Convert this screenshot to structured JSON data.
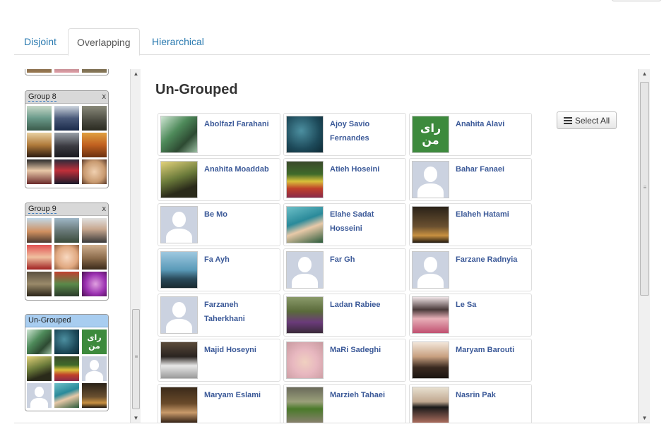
{
  "tabs": [
    {
      "label": "Disjoint",
      "active": false
    },
    {
      "label": "Overlapping",
      "active": true
    },
    {
      "label": "Hierarchical",
      "active": false
    }
  ],
  "sidebar": {
    "groups": [
      {
        "title": "Group 8",
        "close": "x",
        "thumbs": [
          "photo-lake",
          "photo-man-suit",
          "photo-dark",
          "photo-man-outdoor",
          "photo-couple",
          "photo-autumn",
          "photo-woman-scarf",
          "photo-boy-suit",
          "photo-baby"
        ]
      },
      {
        "title": "Group 9",
        "close": "x",
        "thumbs": [
          "photo-sunset",
          "photo-coast",
          "photo-woman-hijab",
          "photo-child-red",
          "photo-baby-face",
          "photo-child-smile",
          "photo-woman-shadow",
          "photo-crowd",
          "photo-purple"
        ]
      },
      {
        "title": "Un-Grouped",
        "close": "",
        "thumbs": [
          "photo-man-green",
          "photo-sea",
          "logo-green",
          "photo-woman-yellow",
          "photo-flowers",
          "placeholder",
          "placeholder",
          "photo-woman-teal",
          "photo-night"
        ]
      }
    ]
  },
  "main": {
    "title": "Un-Grouped",
    "select_all_label": "Select All",
    "people": [
      {
        "name": "Abolfazl Farahani",
        "photo": "photo-man-green"
      },
      {
        "name": "Ajoy Savio Fernandes",
        "photo": "photo-sea"
      },
      {
        "name": "Anahita Alavi",
        "photo": "logo-green"
      },
      {
        "name": "Anahita Moaddab",
        "photo": "photo-woman-yellow"
      },
      {
        "name": "Atieh Hoseini",
        "photo": "photo-flowers"
      },
      {
        "name": "Bahar Fanaei",
        "photo": "placeholder"
      },
      {
        "name": "Be Mo",
        "photo": "placeholder"
      },
      {
        "name": "Elahe Sadat Hosseini",
        "photo": "photo-woman-teal"
      },
      {
        "name": "Elaheh Hatami",
        "photo": "photo-night"
      },
      {
        "name": "Fa Ayh",
        "photo": "photo-beach"
      },
      {
        "name": "Far Gh",
        "photo": "placeholder"
      },
      {
        "name": "Farzane Radnyia",
        "photo": "placeholder"
      },
      {
        "name": "Farzaneh Taherkhani",
        "photo": "placeholder"
      },
      {
        "name": "Ladan Rabiee",
        "photo": "photo-woman-purple"
      },
      {
        "name": "Le Sa",
        "photo": "photo-girl-flowers"
      },
      {
        "name": "Majid Hoseyni",
        "photo": "photo-man-white"
      },
      {
        "name": "MaRi Sadeghi",
        "photo": "photo-baby-pink"
      },
      {
        "name": "Maryam Barouti",
        "photo": "photo-woman-dark"
      },
      {
        "name": "Maryam Eslami",
        "photo": "photo-woman-brown"
      },
      {
        "name": "Marzieh Tahaei",
        "photo": "photo-leaves"
      },
      {
        "name": "Nasrin Pak",
        "photo": "photo-woman-glasses"
      }
    ]
  },
  "logo_text": {
    "line1": "رای",
    "line2": "من"
  },
  "colors": {
    "link": "#2a7ab0",
    "name": "#3b5998",
    "selected_header": "#a8cdf0",
    "logo_green": "#3d8a3d"
  }
}
